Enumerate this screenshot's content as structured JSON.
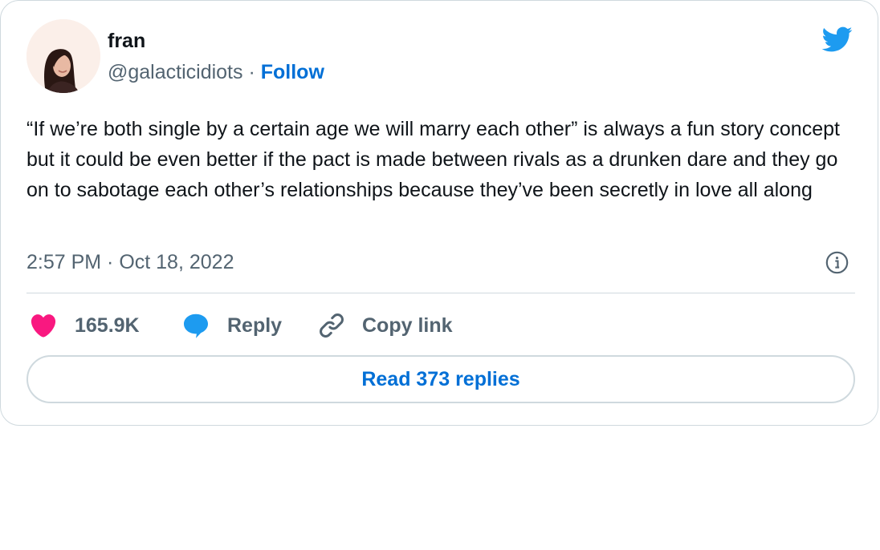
{
  "author": {
    "name": "fran",
    "handle": "@galacticidiots",
    "separator": "·",
    "follow_label": "Follow"
  },
  "tweet": {
    "text": "“If we’re both single by a certain age we will marry each other” is always a fun story concept but it could be even better if the pact is made between rivals as a drunken dare and they go on to sabotage each other’s relationships because they’ve been secretly in love all along",
    "timestamp": "2:57 PM · Oct 18, 2022"
  },
  "actions": {
    "like_count": "165.9K",
    "reply_label": "Reply",
    "copy_link_label": "Copy link"
  },
  "read_replies_label": "Read 373 replies",
  "icons": {
    "logo": "twitter-bird-icon",
    "info": "info-icon",
    "like": "heart-icon",
    "reply": "speech-bubble-icon",
    "copy": "link-icon"
  },
  "colors": {
    "accent": "#006fd6",
    "twitter_blue": "#1d9bf0",
    "like_pink": "#f91880",
    "secondary_text": "#536471",
    "border": "#cfd9de"
  }
}
